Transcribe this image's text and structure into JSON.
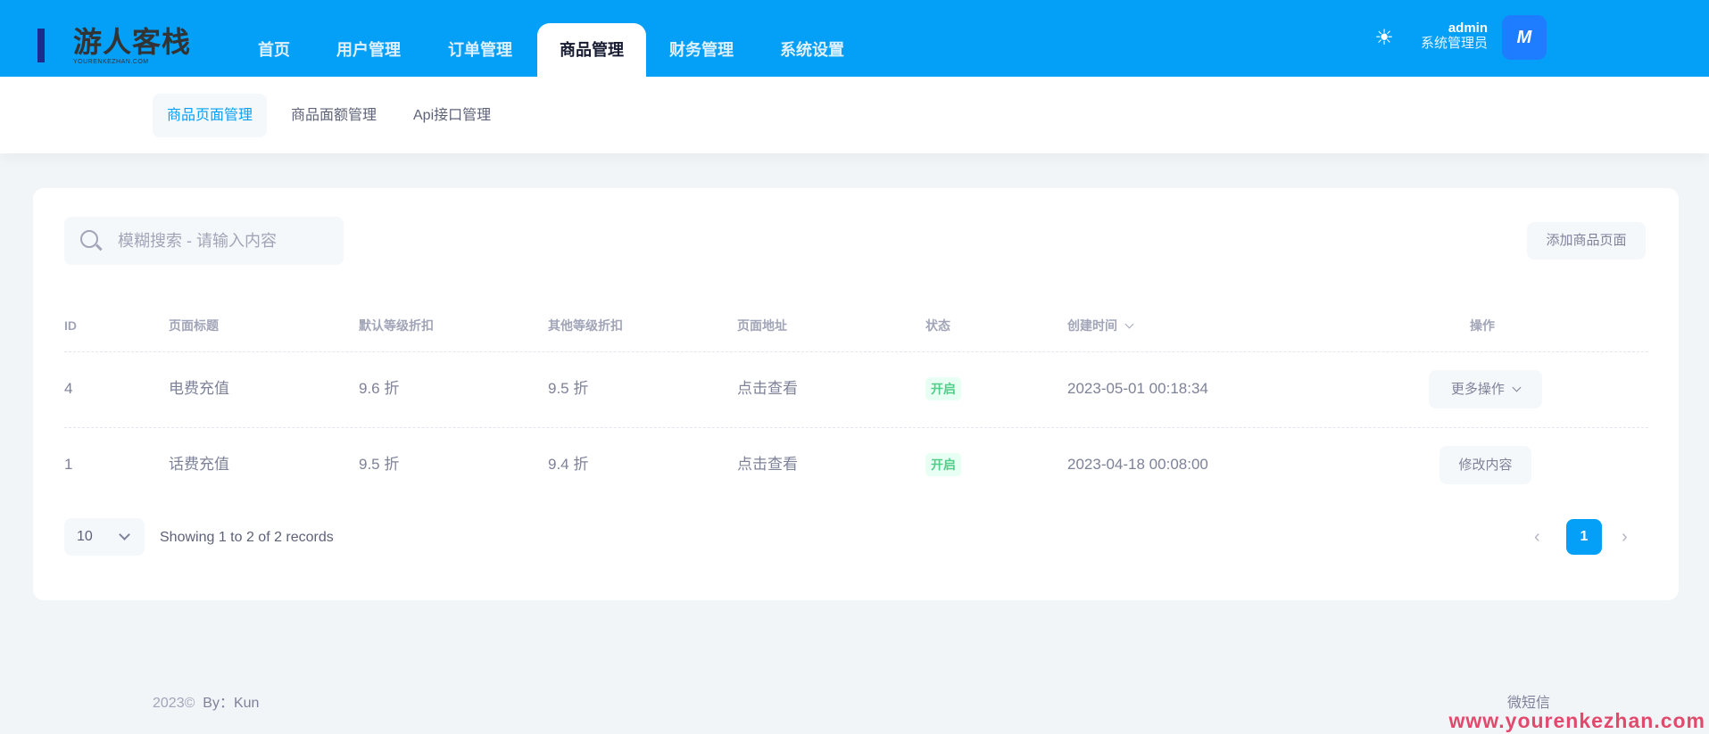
{
  "brand": {
    "title": "游人客栈",
    "url": "YOURENKEZHAN.COM"
  },
  "nav": [
    {
      "label": "首页"
    },
    {
      "label": "用户管理"
    },
    {
      "label": "订单管理"
    },
    {
      "label": "商品管理"
    },
    {
      "label": "财务管理"
    },
    {
      "label": "系统设置"
    }
  ],
  "user": {
    "name": "admin",
    "role": "系统管理员",
    "avatar_text": "M"
  },
  "subnav": [
    {
      "label": "商品页面管理"
    },
    {
      "label": "商品面额管理"
    },
    {
      "label": "Api接口管理"
    }
  ],
  "search": {
    "placeholder": "模糊搜索 - 请输入内容",
    "value": ""
  },
  "add_button": "添加商品页面",
  "table": {
    "headers": [
      "ID",
      "页面标题",
      "默认等级折扣",
      "其他等级折扣",
      "页面地址",
      "状态",
      "创建时间",
      "操作"
    ],
    "rows": [
      {
        "id": "4",
        "title": "电费充值",
        "default_discount": "9.6 折",
        "other_discount": "9.5 折",
        "address": "点击查看",
        "status": "开启",
        "created": "2023-05-01 00:18:34",
        "action": "更多操作"
      },
      {
        "id": "1",
        "title": "话费充值",
        "default_discount": "9.5 折",
        "other_discount": "9.4 折",
        "address": "点击查看",
        "status": "开启",
        "created": "2023-04-18 00:08:00",
        "action": "修改内容"
      }
    ]
  },
  "pagination": {
    "page_size": "10",
    "summary": "Showing 1 to 2 of 2 records",
    "current_page": "1"
  },
  "footer": {
    "copyright": "2023©",
    "by": "By：Kun",
    "right": "微短信"
  },
  "watermark": "www.yourenkezhan.com",
  "colors": {
    "primary": "#049ff6",
    "success": "#50cd89"
  }
}
